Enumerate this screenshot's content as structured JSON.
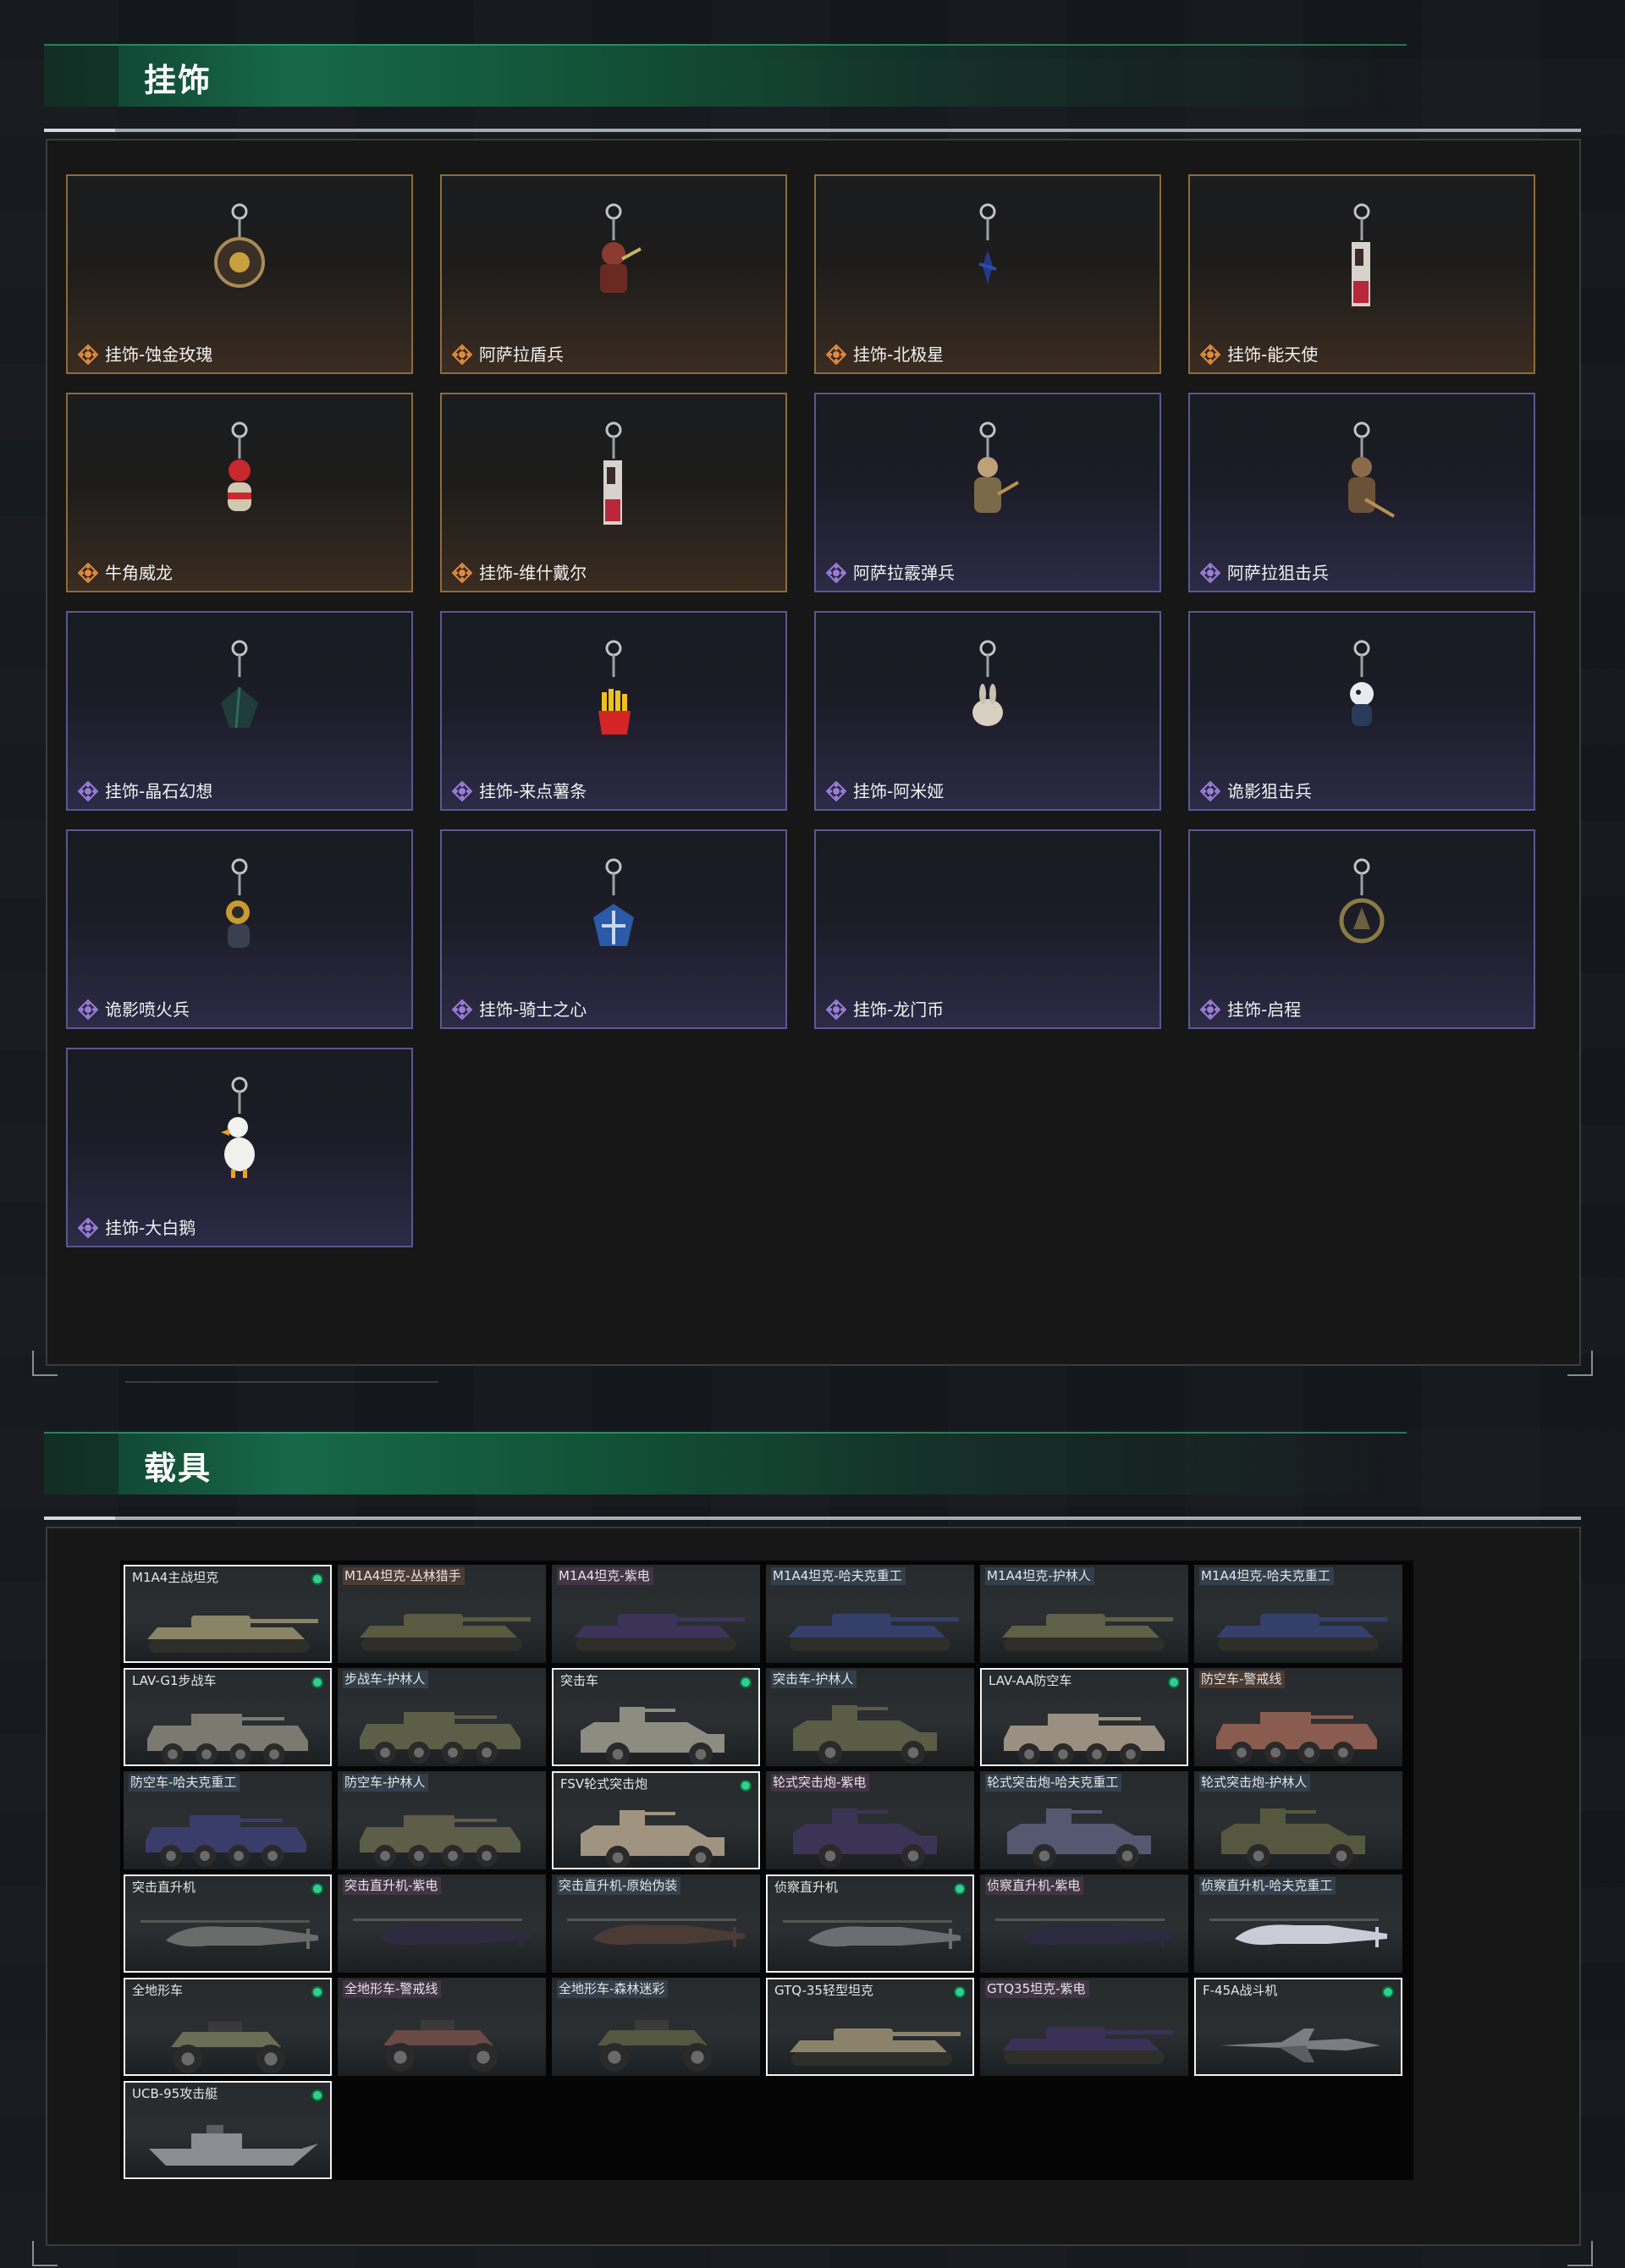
{
  "sections": {
    "charms_title": "挂饰",
    "vehicles_title": "载具"
  },
  "charms": [
    {
      "name": "挂饰-蚀金玫瑰",
      "rarity": "gold",
      "icon": "rose-badge-charm"
    },
    {
      "name": "阿萨拉盾兵",
      "rarity": "gold",
      "icon": "shield-soldier-charm"
    },
    {
      "name": "挂饰-北极星",
      "rarity": "gold",
      "icon": "star-charm"
    },
    {
      "name": "挂饰-能天使",
      "rarity": "gold",
      "icon": "tag-charm"
    },
    {
      "name": "牛角威龙",
      "rarity": "gold",
      "icon": "dragon-figure-charm"
    },
    {
      "name": "挂饰-维什戴尔",
      "rarity": "gold",
      "icon": "tag-charm"
    },
    {
      "name": "阿萨拉霰弹兵",
      "rarity": "purple",
      "icon": "soldier-figure-charm"
    },
    {
      "name": "阿萨拉狙击兵",
      "rarity": "purple",
      "icon": "sniper-figure-charm"
    },
    {
      "name": "挂饰-晶石幻想",
      "rarity": "purple",
      "icon": "crystal-charm"
    },
    {
      "name": "挂饰-来点薯条",
      "rarity": "purple",
      "icon": "fries-charm"
    },
    {
      "name": "挂饰-阿米娅",
      "rarity": "purple",
      "icon": "bunny-charm"
    },
    {
      "name": "诡影狙击兵",
      "rarity": "purple",
      "icon": "ghost-figure-charm"
    },
    {
      "name": "诡影喷火兵",
      "rarity": "purple",
      "icon": "flamer-figure-charm"
    },
    {
      "name": "挂饰-骑士之心",
      "rarity": "purple",
      "icon": "knight-cross-charm"
    },
    {
      "name": "挂饰-龙门币",
      "rarity": "purple",
      "icon": "coin-charm"
    },
    {
      "name": "挂饰-启程",
      "rarity": "purple",
      "icon": "ring-badge-charm"
    },
    {
      "name": "挂饰-大白鹅",
      "rarity": "purple",
      "icon": "goose-charm"
    }
  ],
  "vehicles": [
    {
      "name": "M1A4主战坦克",
      "type": "tank",
      "selected": true,
      "owned": true,
      "tag": "none",
      "color": "#8a8466"
    },
    {
      "name": "M1A4坦克-丛林猎手",
      "type": "tank",
      "selected": false,
      "owned": false,
      "tag": "tag3",
      "color": "#5a5a42"
    },
    {
      "name": "M1A4坦克-紫电",
      "type": "tank",
      "selected": false,
      "owned": false,
      "tag": "tag",
      "color": "#3d3358"
    },
    {
      "name": "M1A4坦克-哈夫克重工",
      "type": "tank",
      "selected": false,
      "owned": false,
      "tag": "tag2",
      "color": "#34406a"
    },
    {
      "name": "M1A4坦克-护林人",
      "type": "tank",
      "selected": false,
      "owned": false,
      "tag": "tag2",
      "color": "#5e6048"
    },
    {
      "name": "M1A4坦克-哈夫克重工",
      "type": "tank",
      "selected": false,
      "owned": false,
      "tag": "tag2",
      "color": "#34406a"
    },
    {
      "name": "LAV-G1步战车",
      "type": "apc",
      "selected": true,
      "owned": true,
      "tag": "none",
      "color": "#7b7a70"
    },
    {
      "name": "步战车-护林人",
      "type": "apc",
      "selected": false,
      "owned": false,
      "tag": "tag2",
      "color": "#5c5e48"
    },
    {
      "name": "突击车",
      "type": "jeep",
      "selected": true,
      "owned": true,
      "tag": "none",
      "color": "#8c8c80"
    },
    {
      "name": "突击车-护林人",
      "type": "jeep",
      "selected": false,
      "owned": false,
      "tag": "tag2",
      "color": "#5a5c46"
    },
    {
      "name": "LAV-AA防空车",
      "type": "apc",
      "selected": true,
      "owned": true,
      "tag": "none",
      "color": "#9a9082"
    },
    {
      "name": "防空车-警戒线",
      "type": "apc",
      "selected": false,
      "owned": false,
      "tag": "tag3",
      "color": "#8a5c50"
    },
    {
      "name": "防空车-哈夫克重工",
      "type": "apc",
      "selected": false,
      "owned": false,
      "tag": "tag2",
      "color": "#3a3c6a"
    },
    {
      "name": "防空车-护林人",
      "type": "apc",
      "selected": false,
      "owned": false,
      "tag": "tag2",
      "color": "#5c5e48"
    },
    {
      "name": "FSV轮式突击炮",
      "type": "jeep",
      "selected": true,
      "owned": true,
      "tag": "none",
      "color": "#a09480"
    },
    {
      "name": "轮式突击炮-紫电",
      "type": "jeep",
      "selected": false,
      "owned": false,
      "tag": "tag",
      "color": "#3c3454"
    },
    {
      "name": "轮式突击炮-哈夫克重工",
      "type": "jeep",
      "selected": false,
      "owned": false,
      "tag": "tag2",
      "color": "#555870"
    },
    {
      "name": "轮式突击炮-护林人",
      "type": "jeep",
      "selected": false,
      "owned": false,
      "tag": "tag2",
      "color": "#55583f"
    },
    {
      "name": "突击直升机",
      "type": "heli",
      "selected": true,
      "owned": true,
      "tag": "none",
      "color": "#6a6c6a"
    },
    {
      "name": "突击直升机-紫电",
      "type": "heli",
      "selected": false,
      "owned": false,
      "tag": "tag",
      "color": "#2e2a40"
    },
    {
      "name": "突击直升机-原始伪装",
      "type": "heli",
      "selected": false,
      "owned": false,
      "tag": "tag2",
      "color": "#4a3c34"
    },
    {
      "name": "侦察直升机",
      "type": "heli",
      "selected": true,
      "owned": true,
      "tag": "none",
      "color": "#6a6e70"
    },
    {
      "name": "侦察直升机-紫电",
      "type": "heli",
      "selected": false,
      "owned": false,
      "tag": "tag",
      "color": "#2c2a40"
    },
    {
      "name": "侦察直升机-哈夫克重工",
      "type": "heli",
      "selected": false,
      "owned": false,
      "tag": "tag2",
      "color": "#c9ccd6"
    },
    {
      "name": "全地形车",
      "type": "atv",
      "selected": true,
      "owned": true,
      "tag": "none",
      "color": "#6a6e56"
    },
    {
      "name": "全地形车-警戒线",
      "type": "atv",
      "selected": false,
      "owned": false,
      "tag": "tag",
      "color": "#6a4a44"
    },
    {
      "name": "全地形车-森林迷彩",
      "type": "atv",
      "selected": false,
      "owned": false,
      "tag": "tag2",
      "color": "#545840"
    },
    {
      "name": "GTQ-35轻型坦克",
      "type": "tank",
      "selected": true,
      "owned": true,
      "tag": "none",
      "color": "#8a826a"
    },
    {
      "name": "GTQ35坦克-紫电",
      "type": "tank",
      "selected": false,
      "owned": false,
      "tag": "tag",
      "color": "#3a3058"
    },
    {
      "name": "F-45A战斗机",
      "type": "jet",
      "selected": true,
      "owned": true,
      "tag": "none",
      "color": "#7a7e84"
    },
    {
      "name": "UCB-95攻击艇",
      "type": "boat",
      "selected": true,
      "owned": true,
      "tag": "none",
      "color": "#8a8e92"
    }
  ],
  "colors": {
    "accent_green": "#2fd08a",
    "gold_border": "#8d6b3d",
    "purple_border": "#5d5690"
  }
}
